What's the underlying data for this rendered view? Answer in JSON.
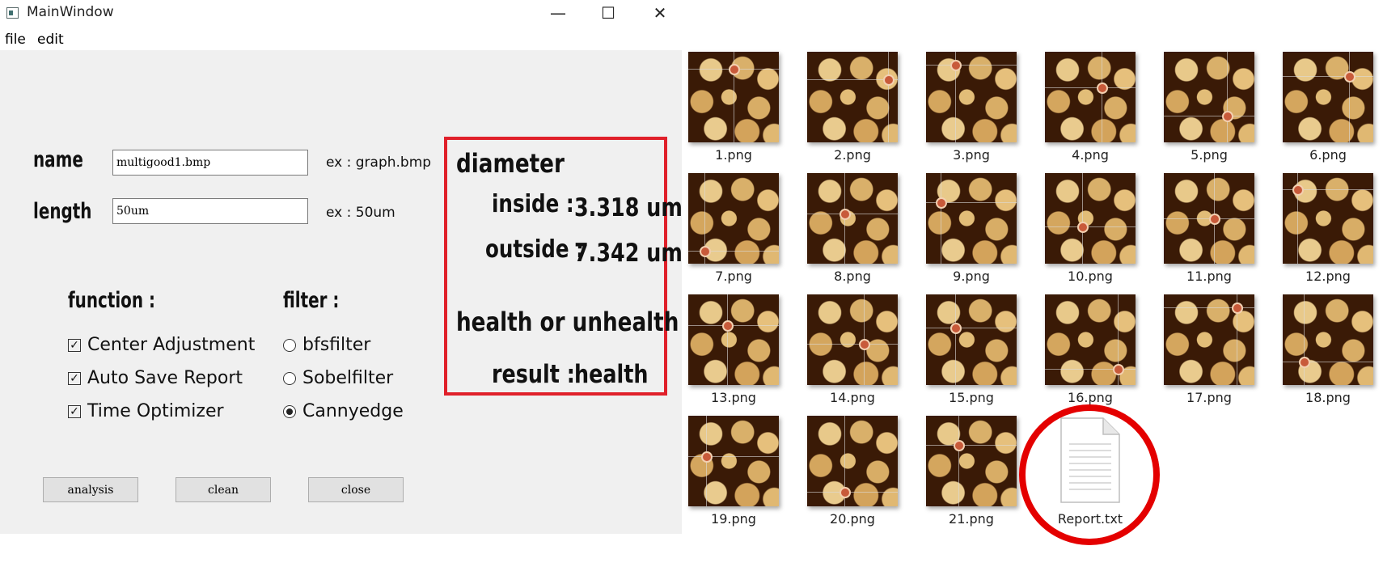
{
  "window": {
    "title": "MainWindow",
    "minimize_glyph": "—",
    "maximize_glyph": "☐",
    "close_glyph": "✕"
  },
  "menu": [
    "file",
    "edit"
  ],
  "form": {
    "name_label": "name",
    "name_value": "multigood1.bmp",
    "name_example": "ex : graph.bmp",
    "length_label": "length",
    "length_value": "50um",
    "length_example": "ex : 50um"
  },
  "function": {
    "heading": "function :",
    "options": [
      {
        "label": "Center Adjustment",
        "checked": true
      },
      {
        "label": "Auto Save Report",
        "checked": true
      },
      {
        "label": "Time Optimizer",
        "checked": true
      }
    ]
  },
  "filter": {
    "heading": "filter :",
    "options": [
      {
        "label": "bfsfilter",
        "selected": false
      },
      {
        "label": "Sobelfilter",
        "selected": false
      },
      {
        "label": "Cannyedge",
        "selected": true
      }
    ]
  },
  "buttons": {
    "analysis": "analysis",
    "clean": "clean",
    "close": "close"
  },
  "results": {
    "diameter_heading": "diameter",
    "inside_label": "inside :",
    "inside_value": "3.318 um",
    "outside_label": "outside :",
    "outside_value": "7.342 um",
    "health_heading": "health or unhealth",
    "result_label": "result :",
    "result_value": "health",
    "highlight_color": "#e0202a"
  },
  "files": [
    "1.png",
    "2.png",
    "3.png",
    "4.png",
    "5.png",
    "6.png",
    "7.png",
    "8.png",
    "9.png",
    "10.png",
    "11.png",
    "12.png",
    "13.png",
    "14.png",
    "15.png",
    "16.png",
    "17.png",
    "18.png",
    "19.png",
    "20.png",
    "21.png"
  ],
  "report_file": "Report.txt"
}
